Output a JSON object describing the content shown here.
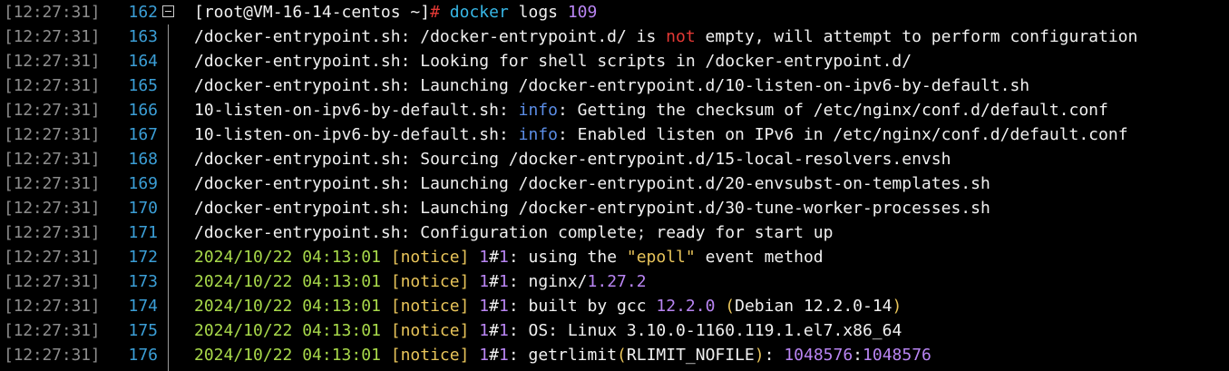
{
  "colors": {
    "background": "#000000",
    "timestamp": "#8c8c8c",
    "line_number": "#3b9ed6",
    "text": "#f0f0f0",
    "prompt_hash": "#e53935",
    "command": "#37b7e6",
    "number": "#b985f3",
    "date": "#a8d94a",
    "notice": "#e8c45a",
    "info": "#5b8de6"
  },
  "terminal": {
    "lines": [
      {
        "timestamp": "[12:27:31]",
        "number": "162",
        "segments": [
          {
            "text": "[root@VM-16-14-centos ~]",
            "color": "white"
          },
          {
            "text": "# ",
            "color": "red"
          },
          {
            "text": "docker",
            "color": "cyan"
          },
          {
            "text": " logs ",
            "color": "white"
          },
          {
            "text": "109",
            "color": "purple"
          }
        ]
      },
      {
        "timestamp": "[12:27:31]",
        "number": "163",
        "segments": [
          {
            "text": "/docker-entrypoint.sh: /docker-entrypoint.d/ is ",
            "color": "white"
          },
          {
            "text": "not",
            "color": "red"
          },
          {
            "text": " empty, will attempt to perform configuration",
            "color": "white"
          }
        ]
      },
      {
        "timestamp": "[12:27:31]",
        "number": "164",
        "segments": [
          {
            "text": "/docker-entrypoint.sh: Looking for shell scripts in /docker-entrypoint.d/",
            "color": "white"
          }
        ]
      },
      {
        "timestamp": "[12:27:31]",
        "number": "165",
        "segments": [
          {
            "text": "/docker-entrypoint.sh: Launching /docker-entrypoint.d/10-listen-on-ipv6-by-default.sh",
            "color": "white"
          }
        ]
      },
      {
        "timestamp": "[12:27:31]",
        "number": "166",
        "segments": [
          {
            "text": "10-listen-on-ipv6-by-default.sh: ",
            "color": "white"
          },
          {
            "text": "info",
            "color": "blue"
          },
          {
            "text": ": Getting the checksum of /etc/nginx/conf.d/default.conf",
            "color": "white"
          }
        ]
      },
      {
        "timestamp": "[12:27:31]",
        "number": "167",
        "segments": [
          {
            "text": "10-listen-on-ipv6-by-default.sh: ",
            "color": "white"
          },
          {
            "text": "info",
            "color": "blue"
          },
          {
            "text": ": Enabled listen on IPv6 in /etc/nginx/conf.d/default.conf",
            "color": "white"
          }
        ]
      },
      {
        "timestamp": "[12:27:31]",
        "number": "168",
        "segments": [
          {
            "text": "/docker-entrypoint.sh: Sourcing /docker-entrypoint.d/15-local-resolvers.envsh",
            "color": "white"
          }
        ]
      },
      {
        "timestamp": "[12:27:31]",
        "number": "169",
        "segments": [
          {
            "text": "/docker-entrypoint.sh: Launching /docker-entrypoint.d/20-envsubst-on-templates.sh",
            "color": "white"
          }
        ]
      },
      {
        "timestamp": "[12:27:31]",
        "number": "170",
        "segments": [
          {
            "text": "/docker-entrypoint.sh: Launching /docker-entrypoint.d/30-tune-worker-processes.sh",
            "color": "white"
          }
        ]
      },
      {
        "timestamp": "[12:27:31]",
        "number": "171",
        "segments": [
          {
            "text": "/docker-entrypoint.sh: Configuration complete",
            "color": "white"
          },
          {
            "text": ";",
            "color": "gray"
          },
          {
            "text": " ready for start up",
            "color": "white"
          }
        ]
      },
      {
        "timestamp": "[12:27:31]",
        "number": "172",
        "segments": [
          {
            "text": "2024/10/22 04:13:01",
            "color": "green"
          },
          {
            "text": " ",
            "color": "white"
          },
          {
            "text": "[notice]",
            "color": "yellow"
          },
          {
            "text": " ",
            "color": "white"
          },
          {
            "text": "1",
            "color": "purple"
          },
          {
            "text": "#",
            "color": "white"
          },
          {
            "text": "1",
            "color": "purple"
          },
          {
            "text": ": using the ",
            "color": "white"
          },
          {
            "text": "\"epoll\"",
            "color": "yellow"
          },
          {
            "text": " event method",
            "color": "white"
          }
        ]
      },
      {
        "timestamp": "[12:27:31]",
        "number": "173",
        "segments": [
          {
            "text": "2024/10/22 04:13:01",
            "color": "green"
          },
          {
            "text": " ",
            "color": "white"
          },
          {
            "text": "[notice]",
            "color": "yellow"
          },
          {
            "text": " ",
            "color": "white"
          },
          {
            "text": "1",
            "color": "purple"
          },
          {
            "text": "#",
            "color": "white"
          },
          {
            "text": "1",
            "color": "purple"
          },
          {
            "text": ": nginx/",
            "color": "white"
          },
          {
            "text": "1.27.2",
            "color": "purple"
          }
        ]
      },
      {
        "timestamp": "[12:27:31]",
        "number": "174",
        "segments": [
          {
            "text": "2024/10/22 04:13:01",
            "color": "green"
          },
          {
            "text": " ",
            "color": "white"
          },
          {
            "text": "[notice]",
            "color": "yellow"
          },
          {
            "text": " ",
            "color": "white"
          },
          {
            "text": "1",
            "color": "purple"
          },
          {
            "text": "#",
            "color": "white"
          },
          {
            "text": "1",
            "color": "purple"
          },
          {
            "text": ": built by gcc ",
            "color": "white"
          },
          {
            "text": "12.2.0",
            "color": "purple"
          },
          {
            "text": " ",
            "color": "white"
          },
          {
            "text": "(",
            "color": "yellow"
          },
          {
            "text": "Debian 12.2.0-14",
            "color": "white"
          },
          {
            "text": ")",
            "color": "yellow"
          }
        ]
      },
      {
        "timestamp": "[12:27:31]",
        "number": "175",
        "segments": [
          {
            "text": "2024/10/22 04:13:01",
            "color": "green"
          },
          {
            "text": " ",
            "color": "white"
          },
          {
            "text": "[notice]",
            "color": "yellow"
          },
          {
            "text": " ",
            "color": "white"
          },
          {
            "text": "1",
            "color": "purple"
          },
          {
            "text": "#",
            "color": "white"
          },
          {
            "text": "1",
            "color": "purple"
          },
          {
            "text": ": OS: Linux 3.10.0-1160.119.1.el7.x86_64",
            "color": "white"
          }
        ]
      },
      {
        "timestamp": "[12:27:31]",
        "number": "176",
        "segments": [
          {
            "text": "2024/10/22 04:13:01",
            "color": "green"
          },
          {
            "text": " ",
            "color": "white"
          },
          {
            "text": "[notice]",
            "color": "yellow"
          },
          {
            "text": " ",
            "color": "white"
          },
          {
            "text": "1",
            "color": "purple"
          },
          {
            "text": "#",
            "color": "white"
          },
          {
            "text": "1",
            "color": "purple"
          },
          {
            "text": ": getrlimit",
            "color": "white"
          },
          {
            "text": "(",
            "color": "yellow"
          },
          {
            "text": "RLIMIT_NOFILE",
            "color": "white"
          },
          {
            "text": ")",
            "color": "yellow"
          },
          {
            "text": ": ",
            "color": "white"
          },
          {
            "text": "1048576",
            "color": "purple"
          },
          {
            "text": ":",
            "color": "white"
          },
          {
            "text": "1048576",
            "color": "purple"
          }
        ]
      }
    ]
  }
}
